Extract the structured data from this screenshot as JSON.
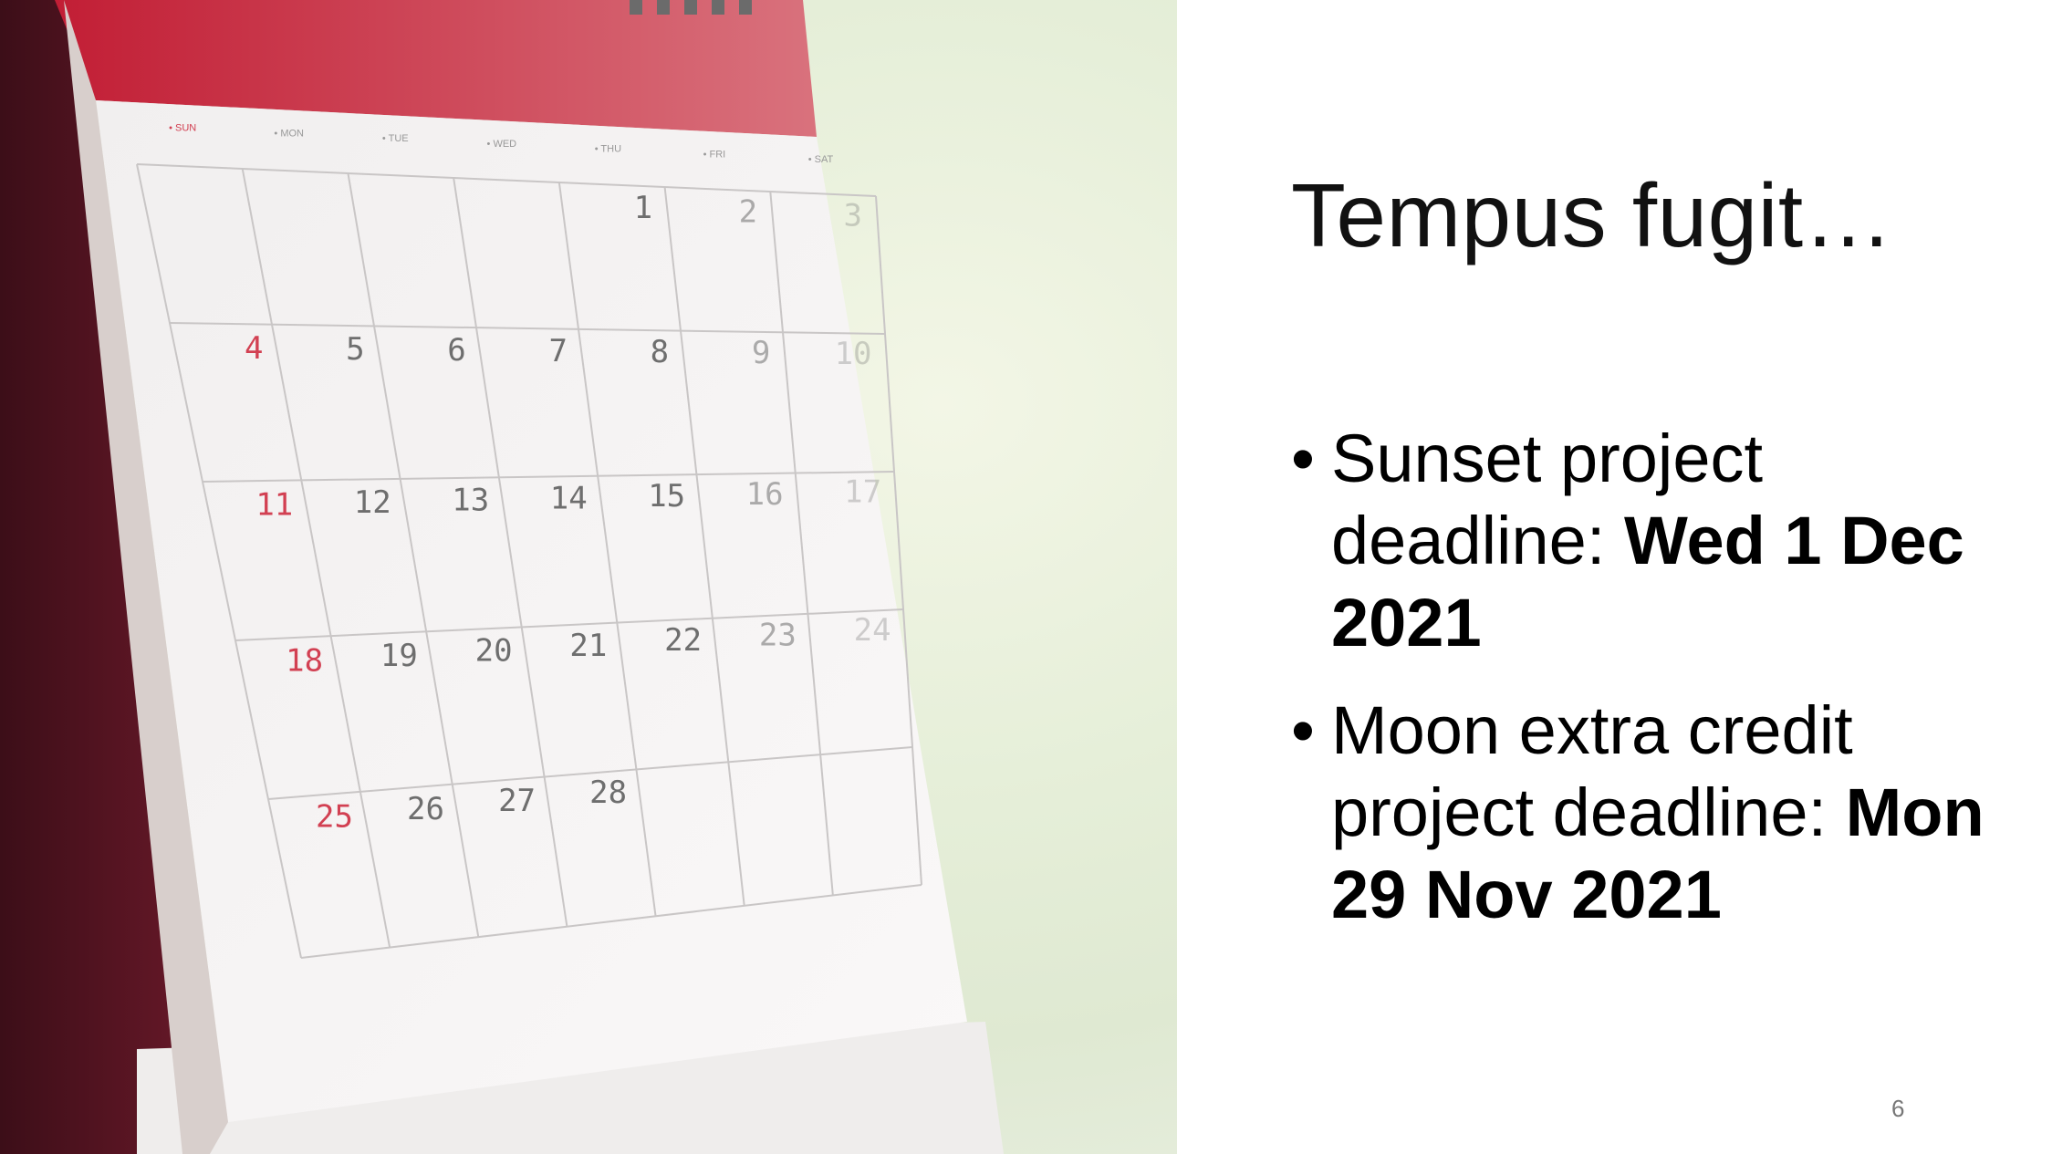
{
  "slide": {
    "title": "Tempus fugit…",
    "bullets": [
      {
        "text": "Sunset project deadline: ",
        "bold": "Wed 1 Dec 2021"
      },
      {
        "text": "Moon extra credit project deadline: ",
        "bold": "Mon 29 Nov 2021"
      }
    ],
    "bullet_glyph": "•",
    "page_number": "6"
  },
  "calendar": {
    "days_header": [
      "SUN",
      "MON",
      "TUE",
      "WED",
      "THU",
      "FRI",
      "SAT"
    ],
    "weeks": [
      [
        "",
        "",
        "",
        "",
        "1",
        "2",
        "3"
      ],
      [
        "4",
        "5",
        "6",
        "7",
        "8",
        "9",
        "10"
      ],
      [
        "11",
        "12",
        "13",
        "14",
        "15",
        "16",
        "17"
      ],
      [
        "18",
        "19",
        "20",
        "21",
        "22",
        "23",
        "24"
      ],
      [
        "25",
        "26",
        "27",
        "28",
        "",
        "",
        ""
      ]
    ]
  },
  "colors": {
    "calendar_red": "#c9243a",
    "calendar_back": "#5a1422",
    "paper": "#f4f2f2",
    "sunday_red": "#d24052",
    "digit_gray": "#6e6e6e"
  }
}
